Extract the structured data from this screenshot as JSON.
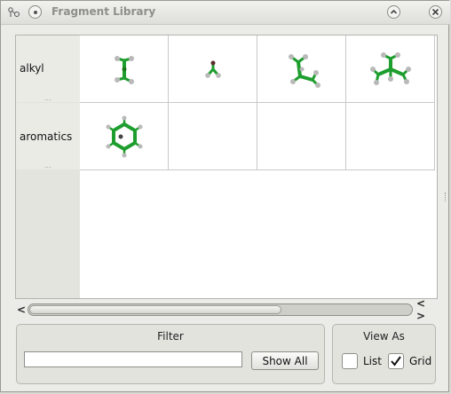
{
  "window": {
    "title": "Fragment Library"
  },
  "rows": [
    {
      "label": "alkyl",
      "dots": "...",
      "fragments": [
        "methane-molecule",
        "methyl-molecule",
        "ethane-molecule",
        "isobutane-molecule"
      ]
    },
    {
      "label": "aromatics",
      "dots": "...",
      "fragments": [
        "benzene-molecule"
      ]
    }
  ],
  "colors": {
    "bond": "#1e9e2e",
    "atom_carbon": "#1a7a1a",
    "atom_hydrogen": "#b9b9b9"
  },
  "filter": {
    "title": "Filter",
    "value": "",
    "show_all_label": "Show All"
  },
  "view_as": {
    "title": "View As",
    "list_label": "List",
    "list_checked": false,
    "grid_label": "Grid",
    "grid_checked": true
  },
  "scrollbar": {
    "left_arrow": "<",
    "right_arrow": "< >"
  }
}
